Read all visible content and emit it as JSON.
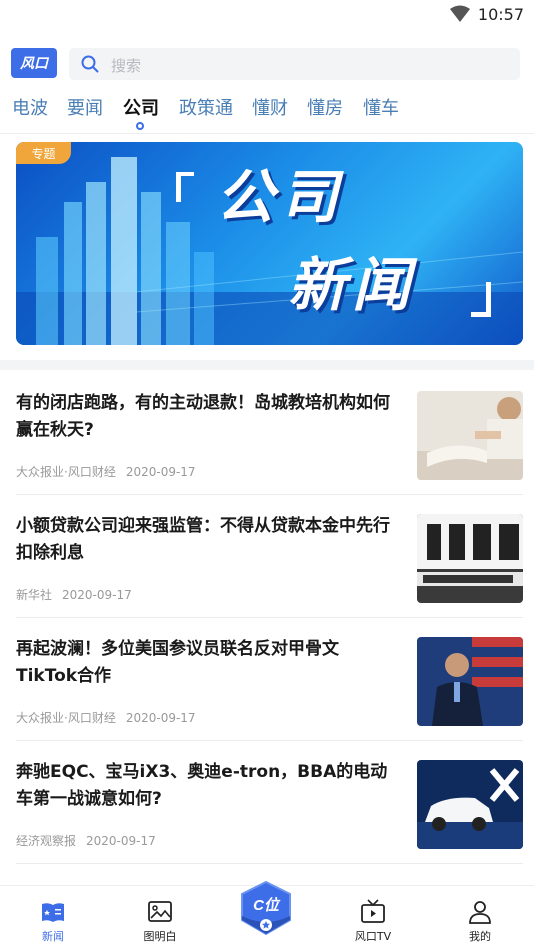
{
  "status_bar": {
    "time": "10:57",
    "wifi_icon": "wifi-icon"
  },
  "header": {
    "logo_text": "风口",
    "search": {
      "placeholder": "搜索",
      "icon": "search-icon"
    }
  },
  "tabs": [
    {
      "label": "电波",
      "active": false
    },
    {
      "label": "要闻",
      "active": false
    },
    {
      "label": "公司",
      "active": true
    },
    {
      "label": "政策通",
      "active": false
    },
    {
      "label": "懂财",
      "active": false
    },
    {
      "label": "懂房",
      "active": false
    },
    {
      "label": "懂车",
      "active": false
    }
  ],
  "banner": {
    "tag": "专题",
    "line1": "公司",
    "line2": "新闻"
  },
  "news": [
    {
      "title": "有的闭店跑路，有的主动退款！岛城教培机构如何赢在秋天?",
      "source": "大众报业·风口财经",
      "date": "2020-09-17",
      "thumb": "reading-book-photo"
    },
    {
      "title": "小额贷款公司迎来强监管：不得从贷款本金中先行扣除利息",
      "source": "新华社",
      "date": "2020-09-17",
      "thumb": "microcredit-sign-photo"
    },
    {
      "title": "再起波澜！多位美国参议员联名反对甲骨文TikTok合作",
      "source": "大众报业·风口财经",
      "date": "2020-09-17",
      "thumb": "speaker-flag-photo"
    },
    {
      "title": "奔驰EQC、宝马iX3、奥迪e-tron，BBA的电动车第一战诚意如何?",
      "source": "经济观察报",
      "date": "2020-09-17",
      "thumb": "white-suv-photo"
    }
  ],
  "bottom_nav": [
    {
      "label": "新闻",
      "icon": "news-book-icon",
      "active": true
    },
    {
      "label": "图明白",
      "icon": "image-icon",
      "active": false
    },
    {
      "label": "C位",
      "icon": "c-position-badge-icon",
      "active": false
    },
    {
      "label": "风口TV",
      "icon": "tv-icon",
      "active": false
    },
    {
      "label": "我的",
      "icon": "user-icon",
      "active": false
    }
  ],
  "colors": {
    "accent": "#3d6ee8",
    "tab_inactive": "#4a7fb5",
    "tag": "#f0a63a"
  }
}
